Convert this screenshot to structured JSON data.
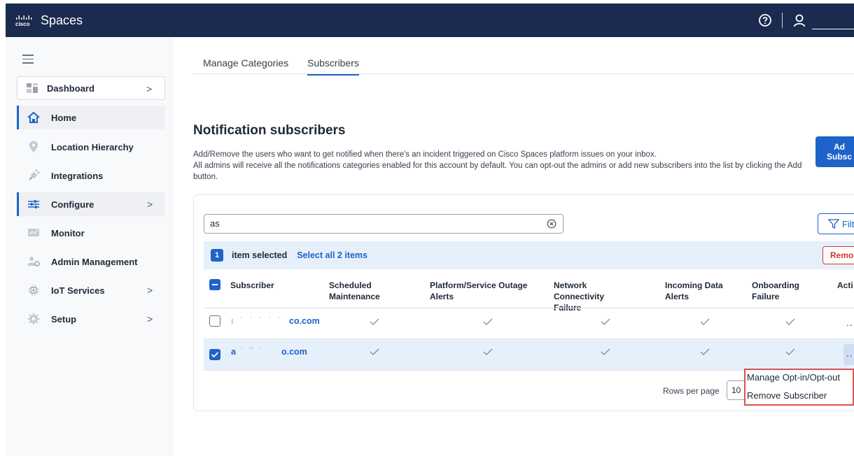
{
  "app": {
    "brand": "cisco",
    "title": "Spaces"
  },
  "sidebar": {
    "items": [
      {
        "label": "Dashboard",
        "icon": "dashboard-icon",
        "has_chevron": true
      },
      {
        "label": "Home",
        "icon": "home-icon",
        "has_chevron": false
      },
      {
        "label": "Location Hierarchy",
        "icon": "location-pin-icon",
        "has_chevron": false
      },
      {
        "label": "Integrations",
        "icon": "plug-icon",
        "has_chevron": false
      },
      {
        "label": "Configure",
        "icon": "sliders-icon",
        "has_chevron": true
      },
      {
        "label": "Monitor",
        "icon": "monitor-icon",
        "has_chevron": false
      },
      {
        "label": "Admin Management",
        "icon": "admin-users-icon",
        "has_chevron": false
      },
      {
        "label": "IoT Services",
        "icon": "iot-chip-icon",
        "has_chevron": true
      },
      {
        "label": "Setup",
        "icon": "gear-icon",
        "has_chevron": true
      }
    ],
    "chevron": ">"
  },
  "tabs": [
    {
      "label": "Manage Categories",
      "active": false
    },
    {
      "label": "Subscribers",
      "active": true
    }
  ],
  "main": {
    "title": "Notification subscribers",
    "description_line1": "Add/Remove the users who want to get notified when there's an incident triggered on Cisco Spaces platform issues on your inbox.",
    "description_line2": "All admins will receive all the notifications categories enabled for this account by default. You can opt-out the admins or add new subscribers into the list by clicking the Add button.",
    "add_button_line1": "Ad",
    "add_button_line2": "Subsc"
  },
  "search": {
    "value": "as"
  },
  "filter_label": "Filt",
  "selection": {
    "count": "1",
    "text": "item selected",
    "select_all": "Select all 2 items",
    "remove_label": "Remo"
  },
  "table": {
    "columns": [
      "Subscriber",
      "Scheduled Maintenance",
      "Platform/Service Outage Alerts",
      "Network Connectivity Failure",
      "Incoming Data Alerts",
      "Onboarding Failure",
      "Acti"
    ],
    "rows": [
      {
        "email": "co.com",
        "checked": false,
        "checks": [
          "✓",
          "✓",
          "✓",
          "✓",
          "✓"
        ],
        "actions": ".."
      },
      {
        "email": "o.com",
        "checked": true,
        "checks": [
          "✓",
          "✓",
          "✓",
          "✓",
          "✓"
        ],
        "actions": ".."
      }
    ]
  },
  "pagination": {
    "label": "Rows per page",
    "value": "10"
  },
  "context_menu": {
    "items": [
      "Manage Opt-in/Opt-out",
      "Remove Subscriber"
    ],
    "border_color": "#d9534f"
  },
  "colors": {
    "topbar": "#1b2a4f",
    "accent": "#1d63c9",
    "danger": "#d9342b",
    "selection_bg": "#e6f0fb"
  }
}
